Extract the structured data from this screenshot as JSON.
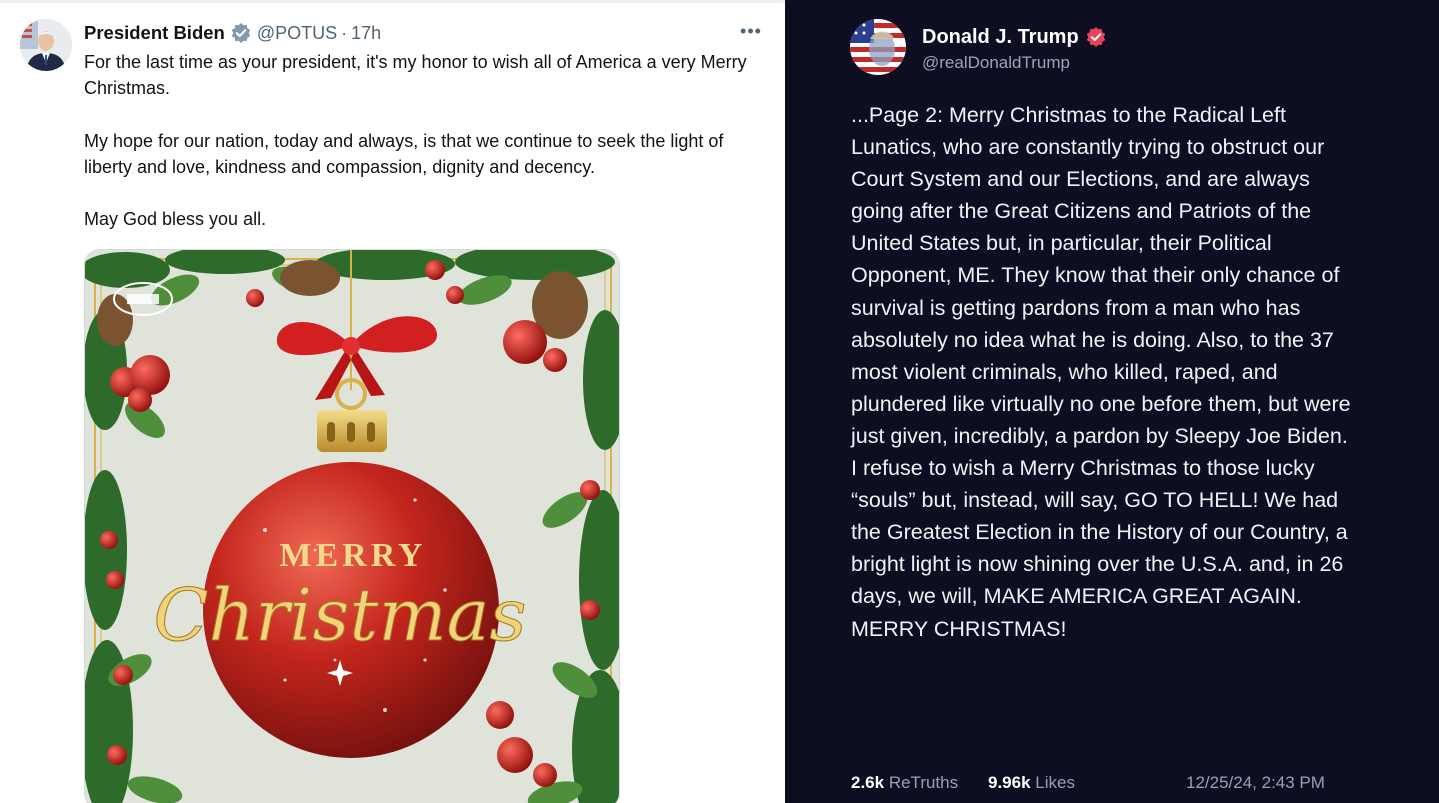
{
  "left_post": {
    "name": "President Biden",
    "verified_icon": "verified-badge-grey",
    "handle": "@POTUS",
    "separator": "·",
    "time": "17h",
    "more_icon": "more-horizontal-icon",
    "more_label": "•••",
    "paragraphs": [
      "For the last time as your president, it's my honor to wish all of America a very Merry Christmas.",
      "My hope for our nation, today and always, is that we continue to seek the light of liberty and love, kindness and compassion, dignity and decency.",
      "May God bless you all."
    ],
    "card": {
      "line1": "MERRY",
      "line2": "Christmas",
      "colors": {
        "ornament": "#c4261d",
        "ribbon": "#d21f1f",
        "gold": "#d8b24a",
        "background": "#dfe3da",
        "holly": "#2e6b2a"
      }
    }
  },
  "right_post": {
    "name": "Donald J. Trump",
    "verified_icon": "verified-badge-red",
    "handle": "@realDonaldTrump",
    "body": "...Page 2: Merry Christmas to the Radical Left Lunatics, who are constantly trying to obstruct our Court System and our Elections, and are always going after the Great Citizens and Patriots of the United States but, in particular, their Political Opponent, ME. They know that their only chance of survival is getting pardons from a man who has absolutely no idea what he is doing. Also, to the 37 most violent criminals, who killed, raped, and plundered like virtually no one before them, but were just given, incredibly, a pardon by Sleepy Joe Biden. I refuse to wish a Merry Christmas to those lucky “souls” but, instead, will say, GO TO HELL! We had the Greatest Election in the History of our Country, a bright light is now shining over the U.S.A. and, in 26 days, we will, MAKE AMERICA GREAT AGAIN. MERRY CHRISTMAS!",
    "retruths_count": "2.6k",
    "retruths_label": "ReTruths",
    "likes_count": "9.96k",
    "likes_label": "Likes",
    "timestamp": "12/25/24, 2:43 PM",
    "colors": {
      "background": "#0d0e22",
      "verified": "#e8435a"
    }
  }
}
